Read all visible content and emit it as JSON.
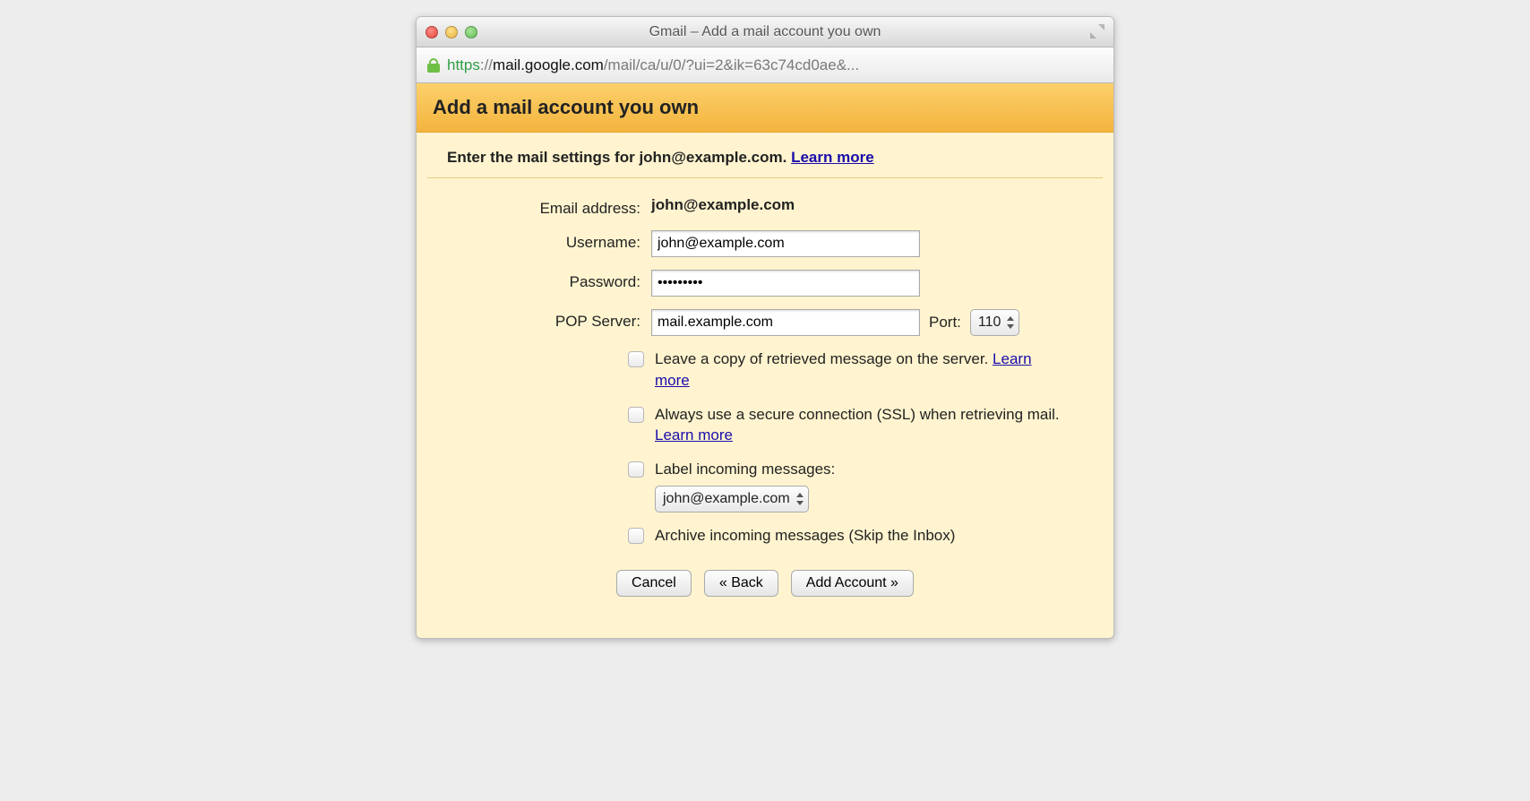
{
  "window": {
    "title": "Gmail – Add a mail account you own"
  },
  "url": {
    "scheme": "https",
    "sep": "://",
    "host": "mail.google.com",
    "path": "/mail/ca/u/0/?ui=2&ik=63c74cd0ae&..."
  },
  "header": {
    "title": "Add a mail account you own"
  },
  "sub": {
    "prefix": "Enter the mail settings for ",
    "email": "john@example.com",
    "suffix": ". ",
    "learn_more": "Learn more"
  },
  "form": {
    "email_label": "Email address:",
    "email_value": "john@example.com",
    "username_label": "Username:",
    "username_value": "john@example.com",
    "password_label": "Password:",
    "password_value": "•••••••••",
    "pop_label": "POP Server:",
    "pop_value": "mail.example.com",
    "port_label": "Port:",
    "port_value": "110"
  },
  "options": {
    "leave_copy": {
      "text": "Leave a copy of retrieved message on the server. ",
      "learn_more": "Learn more"
    },
    "ssl": {
      "text": "Always use a secure connection (SSL) when retrieving mail. ",
      "learn_more": "Learn more"
    },
    "label_msgs": {
      "text": "Label incoming messages:",
      "select_value": "john@example.com"
    },
    "archive": {
      "text": "Archive incoming messages (Skip the Inbox)"
    }
  },
  "buttons": {
    "cancel": "Cancel",
    "back": "« Back",
    "add": "Add Account »"
  }
}
